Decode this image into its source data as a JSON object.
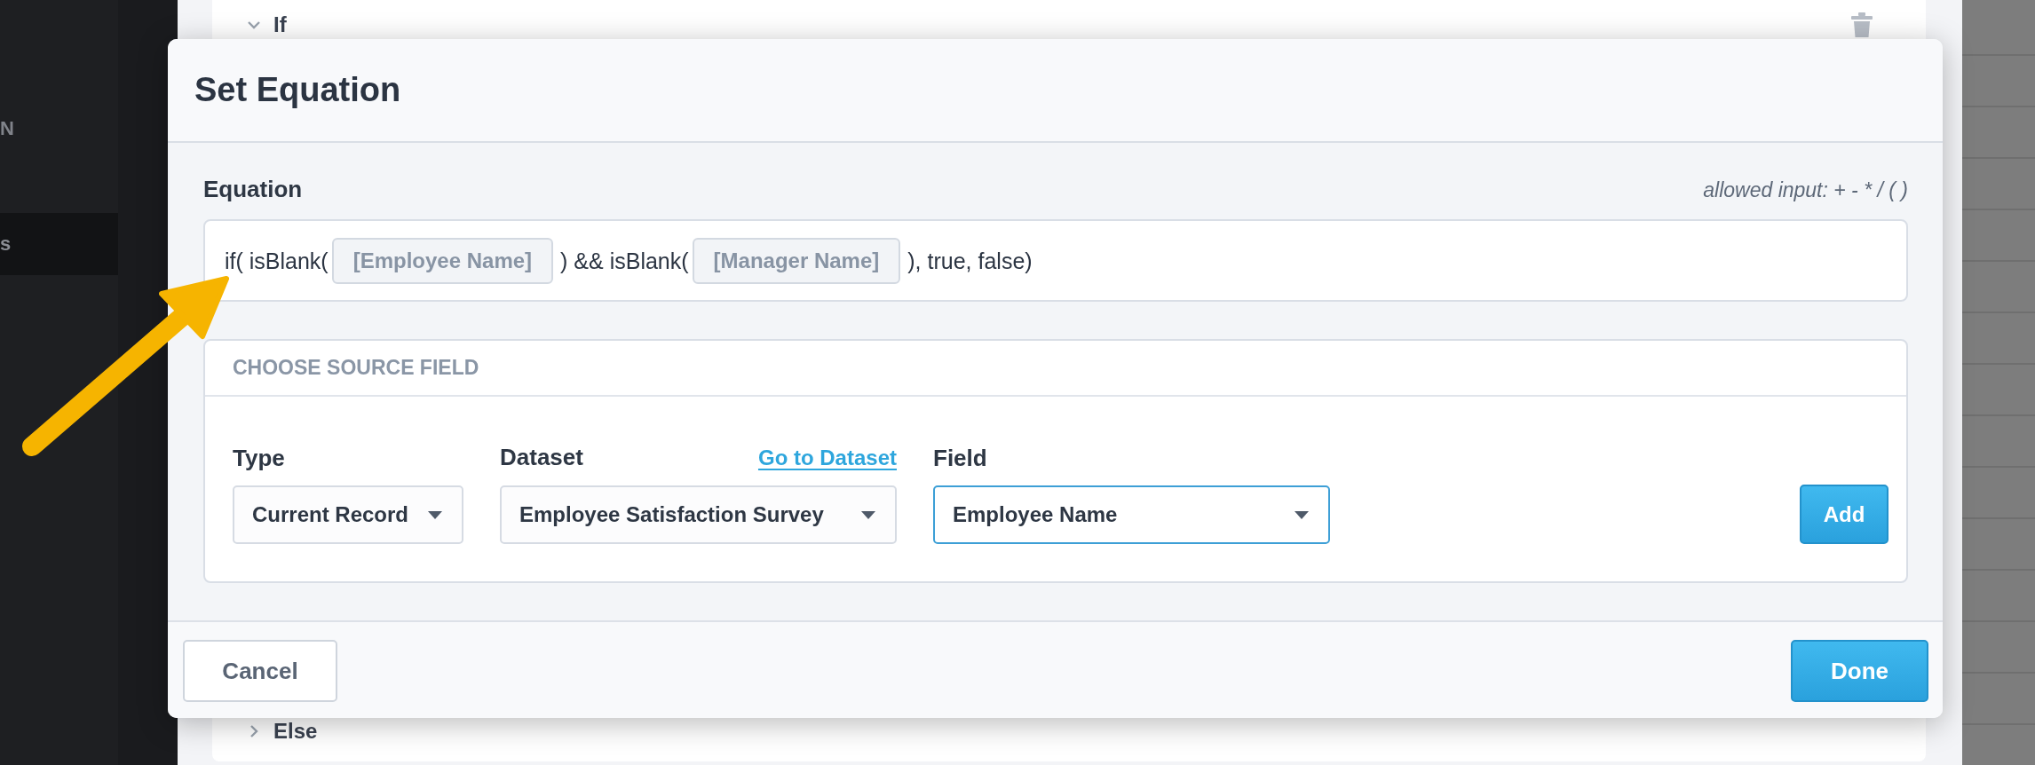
{
  "sidebar": {
    "items": [
      {
        "label": "N",
        "selected": false
      },
      {
        "label": "s",
        "selected": true
      }
    ]
  },
  "background_card": {
    "sections": [
      {
        "label": "If",
        "expanded": true
      },
      {
        "label": "Else",
        "expanded": false
      }
    ]
  },
  "dialog": {
    "title": "Set Equation",
    "equation": {
      "label": "Equation",
      "hint": "allowed input: + - * / ( )",
      "parts": [
        {
          "kind": "text",
          "text": "if( isBlank("
        },
        {
          "kind": "token",
          "text": "[Employee Name]"
        },
        {
          "kind": "text",
          "text": ") && isBlank("
        },
        {
          "kind": "token",
          "text": "[Manager Name]"
        },
        {
          "kind": "text",
          "text": "), true, false)"
        }
      ]
    },
    "source_field": {
      "title": "CHOOSE SOURCE FIELD",
      "fields": [
        {
          "label": "Type",
          "value": "Current Record",
          "focused": false
        },
        {
          "label": "Dataset",
          "link": "Go to Dataset",
          "value": "Employee Satisfaction Survey",
          "focused": false
        },
        {
          "label": "Field",
          "value": "Employee Name",
          "focused": true
        }
      ],
      "add_button": "Add"
    },
    "buttons": [
      {
        "label": "Cancel",
        "kind": "secondary"
      },
      {
        "label": "Done",
        "kind": "primary"
      }
    ]
  }
}
